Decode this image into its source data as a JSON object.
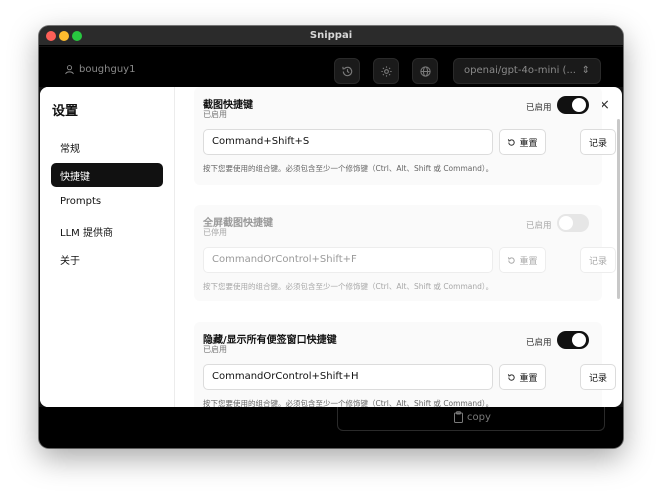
{
  "window": {
    "title": "Snippai"
  },
  "appbar": {
    "username": "boughguy1",
    "model": "openai/gpt-4o-mini (...",
    "icons": [
      "history-icon",
      "settings-icon",
      "globe-icon"
    ]
  },
  "bottombar": {
    "copy_label": "copy"
  },
  "settings": {
    "title": "设置",
    "close": "×",
    "nav": [
      {
        "label": "常规"
      },
      {
        "label": "快捷键",
        "active": true
      },
      {
        "label": "Prompts"
      },
      {
        "label": "LLM 提供商"
      },
      {
        "label": "关于"
      }
    ]
  },
  "shortcuts": [
    {
      "title": "截图快捷键",
      "status": "已启用",
      "toggle_label": "已启用",
      "enabled": true,
      "value": "Command+Shift+S",
      "reset_label": "重置",
      "record_label": "记录",
      "hint": "按下您要使用的组合键。必须包含至少一个修饰键（Ctrl、Alt、Shift 或 Command）。"
    },
    {
      "title": "全屏截图快捷键",
      "status": "已停用",
      "toggle_label": "已启用",
      "enabled": false,
      "value": "CommandOrControl+Shift+F",
      "reset_label": "重置",
      "record_label": "记录",
      "hint": "按下您要使用的组合键。必须包含至少一个修饰键（Ctrl、Alt、Shift 或 Command）。"
    },
    {
      "title": "隐藏/显示所有便签窗口快捷键",
      "status": "已启用",
      "toggle_label": "已启用",
      "enabled": true,
      "value": "CommandOrControl+Shift+H",
      "reset_label": "重置",
      "record_label": "记录",
      "hint": "按下您要使用的组合键。必须包含至少一个修饰键（Ctrl、Alt、Shift 或 Command）。"
    }
  ]
}
